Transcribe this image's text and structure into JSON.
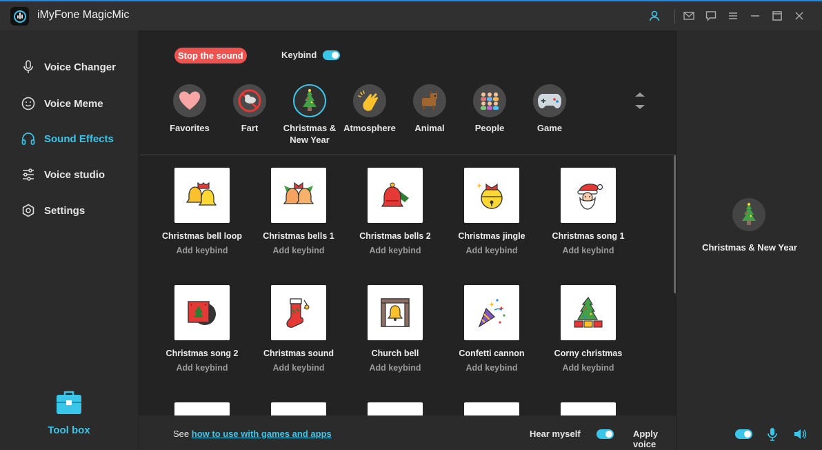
{
  "app": {
    "title": "iMyFone MagicMic"
  },
  "sidebar": {
    "items": [
      {
        "label": "Voice Changer",
        "icon": "microphone-icon"
      },
      {
        "label": "Voice Meme",
        "icon": "smiley-icon"
      },
      {
        "label": "Sound Effects",
        "icon": "headphones-icon",
        "active": true
      },
      {
        "label": "Voice studio",
        "icon": "sliders-icon"
      },
      {
        "label": "Settings",
        "icon": "gear-icon"
      }
    ],
    "toolbox_label": "Tool box"
  },
  "controls": {
    "stop_label": "Stop the sound",
    "keybind_label": "Keybind"
  },
  "categories": [
    {
      "label": "Favorites"
    },
    {
      "label": "Fart"
    },
    {
      "label": "Christmas & New Year",
      "active": true
    },
    {
      "label": "Atmosphere"
    },
    {
      "label": "Animal"
    },
    {
      "label": "People"
    },
    {
      "label": "Game"
    }
  ],
  "sounds": [
    {
      "name": "Christmas bell loop",
      "keybind": "Add keybind"
    },
    {
      "name": "Christmas bells 1",
      "keybind": "Add keybind"
    },
    {
      "name": "Christmas bells 2",
      "keybind": "Add keybind"
    },
    {
      "name": "Christmas jingle",
      "keybind": "Add keybind"
    },
    {
      "name": "Christmas song 1",
      "keybind": "Add keybind"
    },
    {
      "name": "Christmas song 2",
      "keybind": "Add keybind"
    },
    {
      "name": "Christmas sound",
      "keybind": "Add keybind"
    },
    {
      "name": "Church bell",
      "keybind": "Add keybind"
    },
    {
      "name": "Confetti cannon",
      "keybind": "Add keybind"
    },
    {
      "name": "Corny christmas",
      "keybind": "Add keybind"
    }
  ],
  "right_panel": {
    "label": "Christmas & New Year"
  },
  "bottom": {
    "see_prefix": "See",
    "link_text": "how to use with games and apps",
    "hear_myself": "Hear myself",
    "apply_changer": "Apply voice changer"
  },
  "colors": {
    "accent": "#3ac6e9",
    "stop": "#ef5350",
    "titlebar_top": "#1e88e5"
  }
}
